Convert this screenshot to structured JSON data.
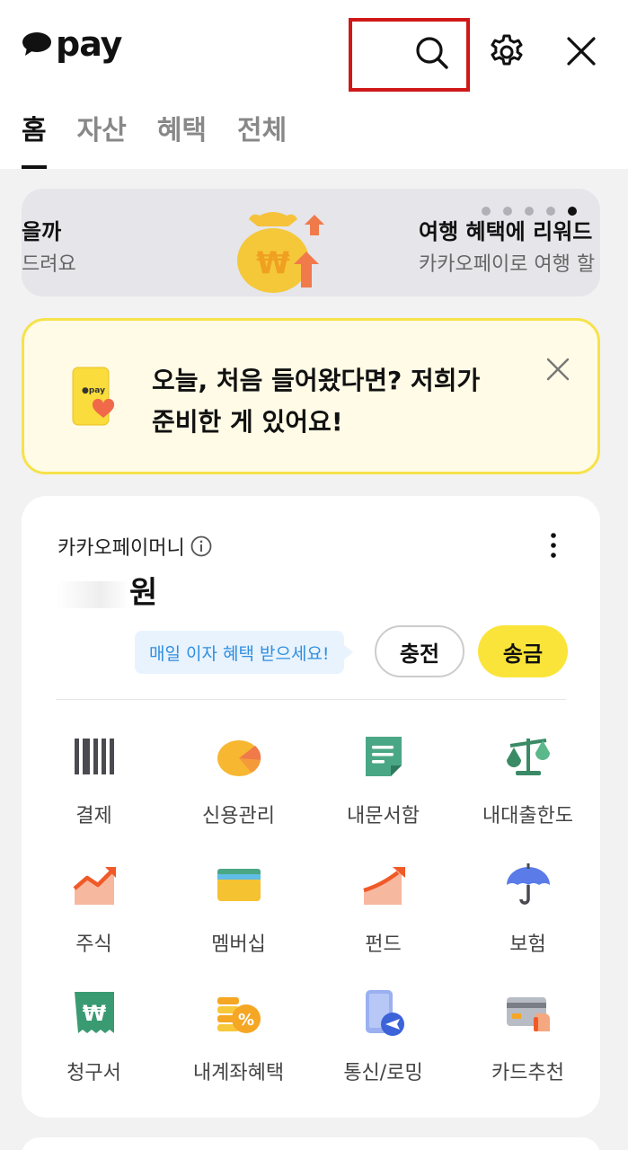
{
  "header": {
    "logo_text": "pay",
    "icons": [
      "search-icon",
      "gear-icon",
      "close-icon"
    ]
  },
  "tabs": [
    {
      "label": "홈",
      "active": true
    },
    {
      "label": "자산",
      "active": false
    },
    {
      "label": "혜택",
      "active": false
    },
    {
      "label": "전체",
      "active": false
    }
  ],
  "banner": {
    "left_title": "을까",
    "left_sub": "드려요",
    "right_title": "여행 혜택에 리워드",
    "right_sub": "카카오페이로 여행 할",
    "slide_count": 5,
    "active_slide": 5
  },
  "notice": {
    "line1": "오늘, 처음 들어왔다면? 저희가",
    "line2": "준비한 게 있어요!"
  },
  "money": {
    "label": "카카오페이머니",
    "amount_suffix": "원",
    "tooltip": "매일 이자 혜택 받으세요!",
    "charge_label": "충전",
    "send_label": "송금"
  },
  "menu": [
    {
      "label": "결제",
      "icon": "barcode-icon"
    },
    {
      "label": "신용관리",
      "icon": "credit-gauge-icon"
    },
    {
      "label": "내문서함",
      "icon": "document-icon"
    },
    {
      "label": "내대출한도",
      "icon": "scale-icon"
    },
    {
      "label": "주식",
      "icon": "stock-chart-icon"
    },
    {
      "label": "멤버십",
      "icon": "wallet-icon"
    },
    {
      "label": "펀드",
      "icon": "fund-chart-icon"
    },
    {
      "label": "보험",
      "icon": "umbrella-icon"
    },
    {
      "label": "청구서",
      "icon": "bill-icon"
    },
    {
      "label": "내계좌혜택",
      "icon": "coin-discount-icon"
    },
    {
      "label": "통신/로밍",
      "icon": "phone-plane-icon"
    },
    {
      "label": "카드추천",
      "icon": "card-icon"
    }
  ],
  "colors": {
    "brand_yellow": "#fae43a",
    "highlight_red": "#d01818",
    "tooltip_blue": "#2f8ee0"
  }
}
